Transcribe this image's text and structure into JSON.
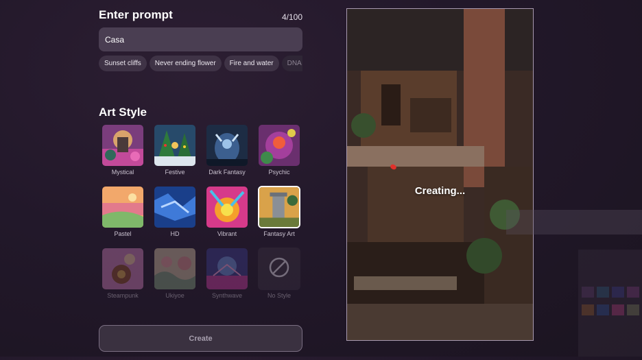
{
  "prompt": {
    "title": "Enter prompt",
    "counter": "4/100",
    "value": "Casa",
    "suggestions": [
      "Sunset cliffs",
      "Never ending flower",
      "Fire and water",
      "DNA tor"
    ]
  },
  "art_style": {
    "title": "Art Style",
    "styles": [
      {
        "label": "Mystical",
        "state": "enabled"
      },
      {
        "label": "Festive",
        "state": "enabled"
      },
      {
        "label": "Dark Fantasy",
        "state": "enabled"
      },
      {
        "label": "Psychic",
        "state": "enabled"
      },
      {
        "label": "Pastel",
        "state": "enabled"
      },
      {
        "label": "HD",
        "state": "enabled"
      },
      {
        "label": "Vibrant",
        "state": "enabled"
      },
      {
        "label": "Fantasy Art",
        "state": "selected"
      },
      {
        "label": "Steampunk",
        "state": "disabled"
      },
      {
        "label": "Ukiyoe",
        "state": "disabled"
      },
      {
        "label": "Synthwave",
        "state": "disabled"
      },
      {
        "label": "No Style",
        "state": "disabled"
      }
    ]
  },
  "create_button": {
    "label": "Create"
  },
  "preview": {
    "status": "Creating..."
  },
  "colors": {
    "background": "#22182a",
    "input": "#4a3e52",
    "chip": "#3f3346",
    "accent": "#ffffff"
  }
}
